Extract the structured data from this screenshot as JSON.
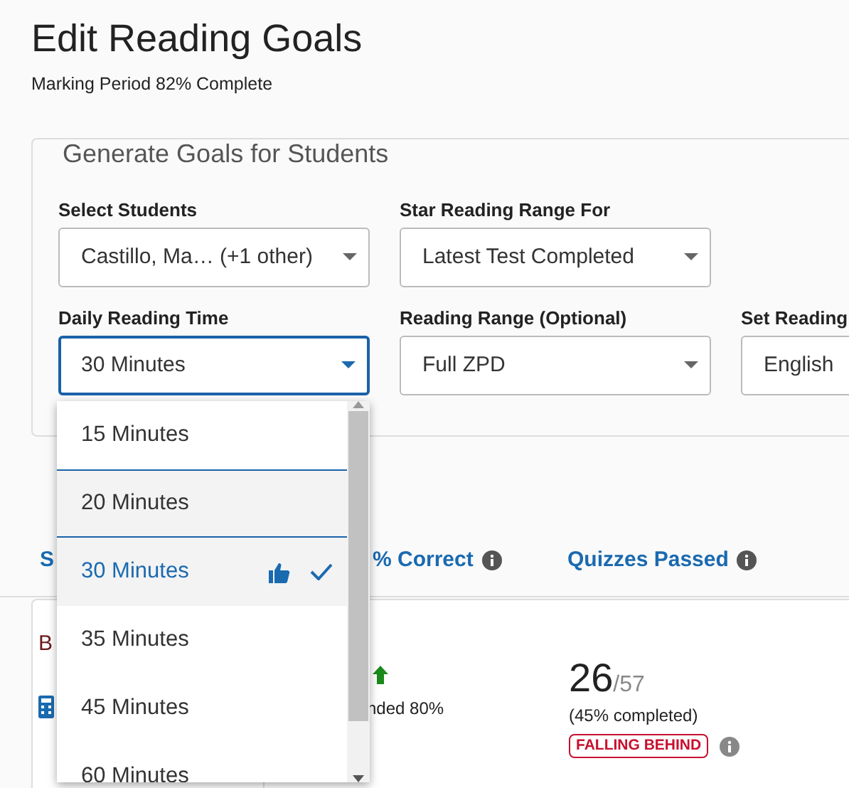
{
  "page": {
    "title": "Edit Reading Goals",
    "subtitle": "Marking Period 82% Complete"
  },
  "goals_panel": {
    "legend": "Generate Goals for Students",
    "field_rows": [
      [
        {
          "label": "Select Students",
          "value": "Castillo, Ma… (+1 other)",
          "focused": false
        },
        {
          "label": "Star Reading Range For",
          "value": "Latest Test Completed",
          "focused": false
        }
      ],
      [
        {
          "label": "Daily Reading Time",
          "value": "30 Minutes",
          "focused": true
        },
        {
          "label": "Reading Range (Optional)",
          "value": "Full ZPD",
          "focused": false
        },
        {
          "label": "Set Reading",
          "value": "English",
          "focused": false
        }
      ]
    ]
  },
  "table": {
    "columns": [
      {
        "label": "S"
      },
      {
        "label": "% Correct",
        "info": true
      },
      {
        "label": "Quizzes Passed",
        "info": true
      }
    ],
    "rows": [
      {
        "column_1": "B",
        "trend_up": true,
        "column_2_note": "nded 80%",
        "quizzes": "26",
        "quizzes_total": "/57",
        "progress": "(45% completed)",
        "status": "FALLING BEHIND"
      }
    ]
  },
  "dropdown": {
    "options": [
      {
        "label": "15 Minutes",
        "selected": false,
        "hovered": false,
        "recommended": false
      },
      {
        "label": "20 Minutes",
        "selected": false,
        "hovered": true,
        "recommended": false
      },
      {
        "label": "30 Minutes",
        "selected": true,
        "hovered": false,
        "recommended": true
      },
      {
        "label": "35 Minutes",
        "selected": false,
        "hovered": false,
        "recommended": false
      },
      {
        "label": "45 Minutes",
        "selected": false,
        "hovered": false,
        "recommended": false
      },
      {
        "label": "60 Minutes",
        "selected": false,
        "hovered": false,
        "recommended": false
      }
    ]
  }
}
